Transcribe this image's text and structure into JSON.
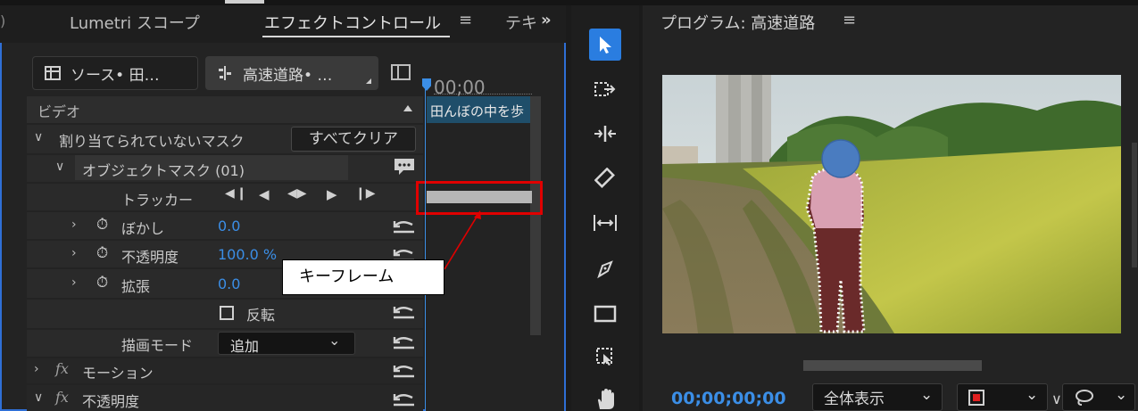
{
  "left_panel": {
    "tabs": [
      {
        "label": "Lumetri スコープ"
      },
      {
        "label": "エフェクトコントロール"
      },
      {
        "label": "テキ"
      }
    ],
    "source_button": "ソース• 田…",
    "sequence_button": "高速道路• …",
    "section_video": "ビデオ",
    "unassigned_mask": "割り当てられていないマスク",
    "clear_all": "すべてクリア",
    "object_mask": "オブジェクトマスク (01)",
    "tracker_label": "トラッカー",
    "properties": [
      {
        "label": "ぼかし",
        "value": "0.0"
      },
      {
        "label": "不透明度",
        "value": "100.0 %"
      },
      {
        "label": "拡張",
        "value": "0.0"
      }
    ],
    "invert_label": "反転",
    "blend_mode_label": "描画モード",
    "blend_mode_value": "追加",
    "motion_label": "モーション",
    "opacity_label": "不透明度",
    "fx_symbol": "fx",
    "timeline_timecode": "00;00",
    "clip_name": "田んぼの中を歩"
  },
  "annotation": {
    "callout_text": "キーフレーム"
  },
  "monitor": {
    "title": "プログラム: 高速道路",
    "timecode": "00;00;00;00",
    "zoom_value": "全体表示"
  },
  "colors": {
    "accent_blue": "#3b8ee6",
    "highlight_red": "#e00000",
    "panel_border": "#2f6fd6"
  }
}
